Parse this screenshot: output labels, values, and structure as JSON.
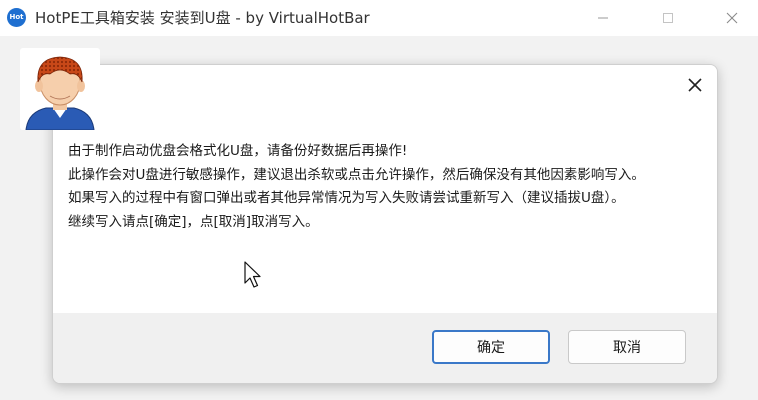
{
  "window": {
    "app_icon_text": "Hot",
    "title": "HotPE工具箱安装 安装到U盘 - by VirtualHotBar"
  },
  "dialog": {
    "message_lines": [
      "由于制作启动优盘会格式化U盘，请备份好数据后再操作!",
      "此操作会对U盘进行敏感操作，建议退出杀软或点击允许操作，然后确保没有其他因素影响写入。",
      "如果写入的过程中有窗口弹出或者其他异常情况为写入失败请尝试重新写入（建议插拔U盘）。",
      "继续写入请点[确定]，点[取消]取消写入。"
    ],
    "ok_label": "确定",
    "cancel_label": "取消"
  },
  "colors": {
    "accent": "#1e6fd0",
    "ok_border": "#3a78c8"
  },
  "icons": [
    "app-logo-icon",
    "minimize-icon",
    "maximize-icon",
    "close-icon",
    "dialog-close-icon",
    "mouse-cursor-icon"
  ]
}
